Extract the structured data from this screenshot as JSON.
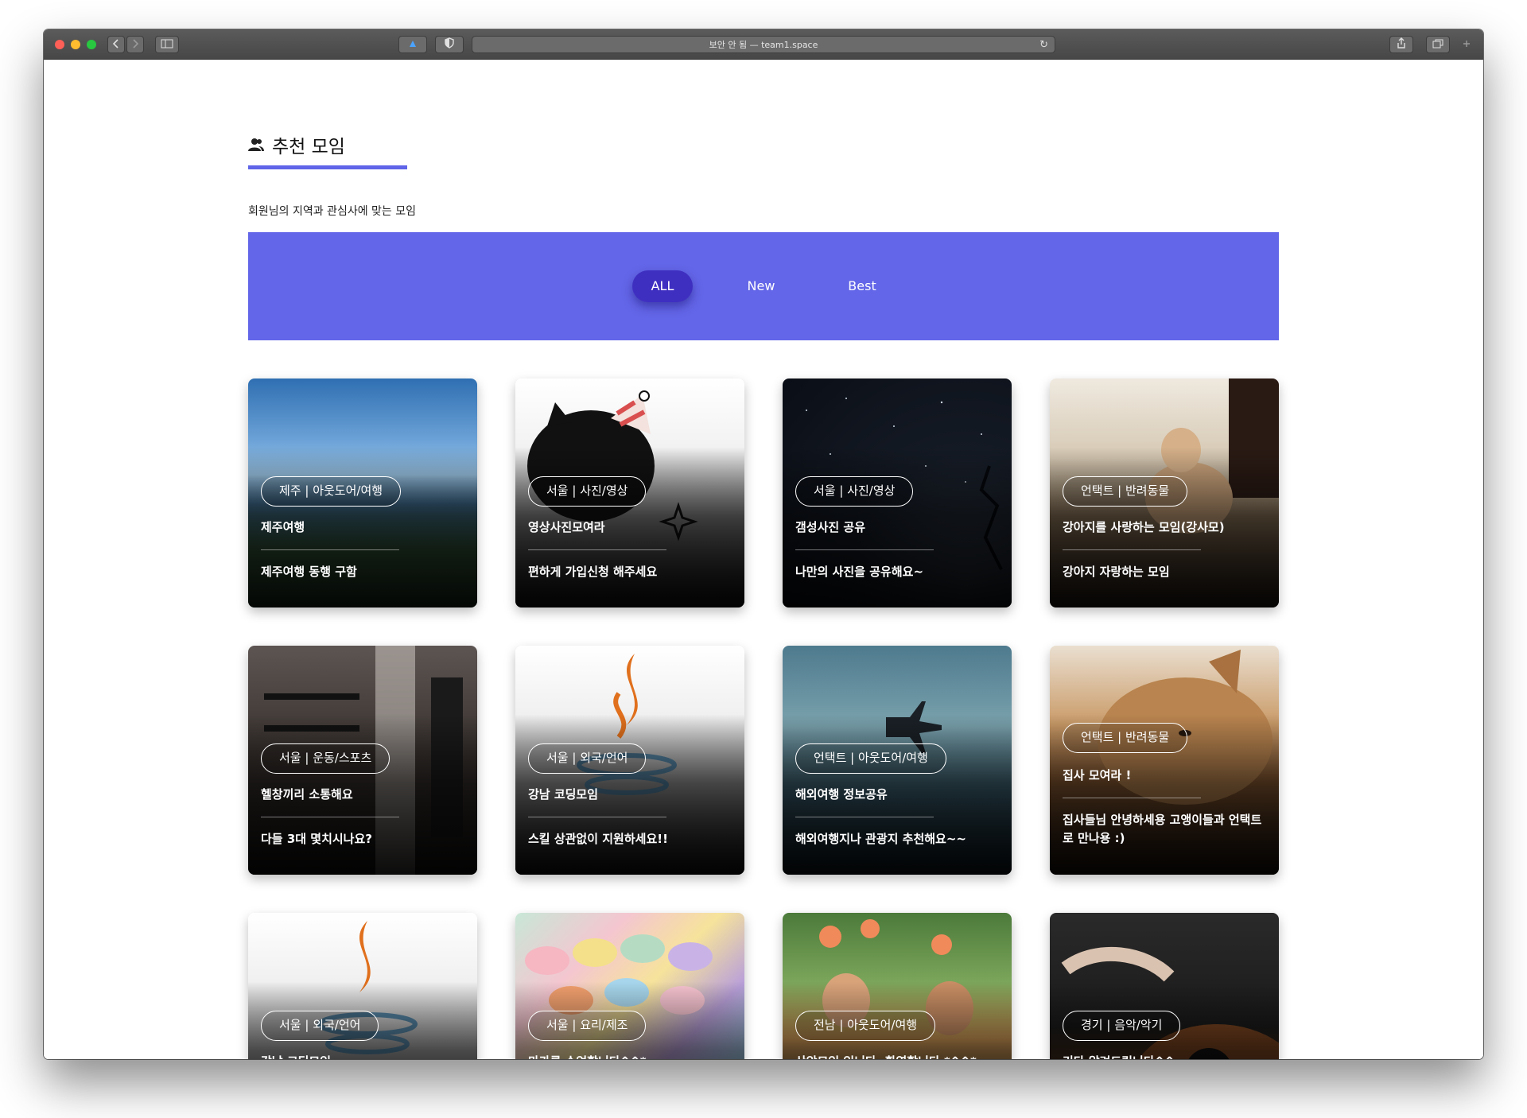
{
  "browser": {
    "url_text": "보안 안 됨 — team1.space",
    "reload_icon": "reload-icon"
  },
  "section": {
    "title": "추천 모임",
    "subtitle": "회원님의 지역과 관심사에 맞는 모임",
    "accent_color": "#5f64e8"
  },
  "filter": {
    "bar_color": "#6366e8",
    "active_color": "#3f2fc1",
    "tabs": [
      "ALL",
      "New",
      "Best"
    ],
    "active_tab": "ALL"
  },
  "cards": [
    {
      "badge": "제주 | 아웃도어/여행",
      "title": "제주여행",
      "desc": "제주여행 동행 구함"
    },
    {
      "badge": "서울 | 사진/영상",
      "title": "영상사진모여라",
      "desc": "편하게 가입신청 해주세요"
    },
    {
      "badge": "서울 | 사진/영상",
      "title": "갬성사진 공유",
      "desc": "나만의 사진을 공유해요~"
    },
    {
      "badge": "언택트 | 반려동물",
      "title": "강아지를 사랑하는 모임(강사모)",
      "desc": "강아지 자랑하는 모임"
    },
    {
      "badge": "서울 | 운동/스포츠",
      "title": "헬창끼리 소통해요",
      "desc": "다들 3대 몇치시나요?"
    },
    {
      "badge": "서울 | 외국/언어",
      "title": "강남 코딩모임",
      "desc": "스킬 상관없이 지원하세요!!"
    },
    {
      "badge": "언택트 | 아웃도어/여행",
      "title": "해외여행 정보공유",
      "desc": "해외여행지나 관광지 추천해요~~"
    },
    {
      "badge": "언택트 | 반려동물",
      "title": "집사 모여라 !",
      "desc": "집사들님 안녕하세용 고앵이들과 언택트로 만나용 :)"
    },
    {
      "badge": "서울 | 외국/언어",
      "title": "강남 코딩모임",
      "desc": ""
    },
    {
      "badge": "서울 | 요리/제조",
      "title": "마카롱 수업합니다^^*",
      "desc": ""
    },
    {
      "badge": "전남 | 아웃도어/여행",
      "title": "산악모임 입니다. 환영합니다 *^^*",
      "desc": ""
    },
    {
      "badge": "경기 | 음악/악기",
      "title": "기타 알려드립니다^^",
      "desc": ""
    }
  ]
}
